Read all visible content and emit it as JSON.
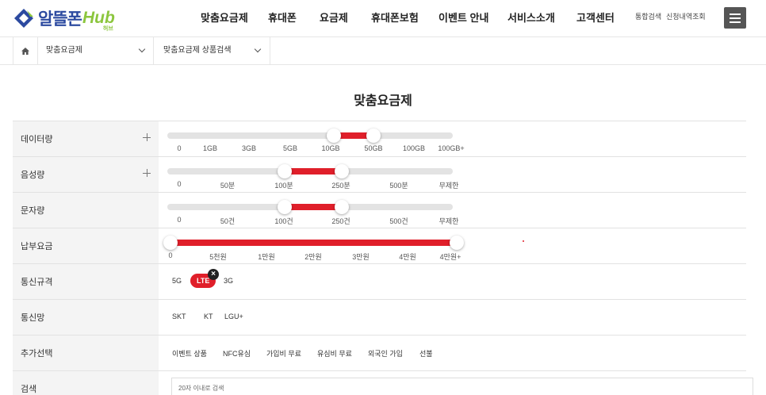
{
  "logo": {
    "brand": "알뜰폰",
    "hub": "Hub",
    "hub_sub": "허브"
  },
  "gnb": [
    "맞춤요금제",
    "휴대폰",
    "요금제",
    "휴대폰보험",
    "이벤트 안내",
    "서비스소개",
    "고객센터"
  ],
  "util": [
    "통합검색",
    "신청내역조회"
  ],
  "breadcrumb": {
    "depth1": "맞춤요금제",
    "depth2": "맞춤요금제 상품검색"
  },
  "page_title": "맞춤요금제",
  "filters": {
    "data": {
      "label": "데이터량",
      "ticks": [
        "0",
        "1GB",
        "3GB",
        "5GB",
        "10GB",
        "50GB",
        "100GB",
        "100GB+"
      ],
      "selected_range": [
        "10GB",
        "50GB"
      ]
    },
    "voice": {
      "label": "음성량",
      "ticks": [
        "0",
        "50분",
        "100분",
        "250분",
        "500분",
        "무제한"
      ],
      "selected_range": [
        "100분",
        "250분"
      ]
    },
    "sms": {
      "label": "문자량",
      "ticks": [
        "0",
        "50건",
        "100건",
        "250건",
        "500건",
        "무제한"
      ],
      "selected_range": [
        "100건",
        "250건"
      ]
    },
    "fee": {
      "label": "납부요금",
      "ticks": [
        "0",
        "5천원",
        "1만원",
        "2만원",
        "3만원",
        "4만원",
        "4만원+"
      ],
      "selected_range": [
        "0",
        "4만원+"
      ]
    },
    "network_type": {
      "label": "통신규격",
      "options": [
        "5G",
        "LTE",
        "3G"
      ],
      "selected": "LTE"
    },
    "carrier": {
      "label": "통신망",
      "options": [
        "SKT",
        "KT",
        "LGU+"
      ]
    },
    "extra": {
      "label": "추가선택",
      "options": [
        "이벤트 상품",
        "NFC유심",
        "가입비 무료",
        "유심비 무료",
        "외국인 가입",
        "선불"
      ]
    },
    "search": {
      "label": "검색",
      "placeholder": "20자 이내로 검색"
    }
  },
  "colors": {
    "accent": "#e01f2a",
    "logo_blue": "#2c4aa0",
    "logo_green": "#8cc63e"
  }
}
